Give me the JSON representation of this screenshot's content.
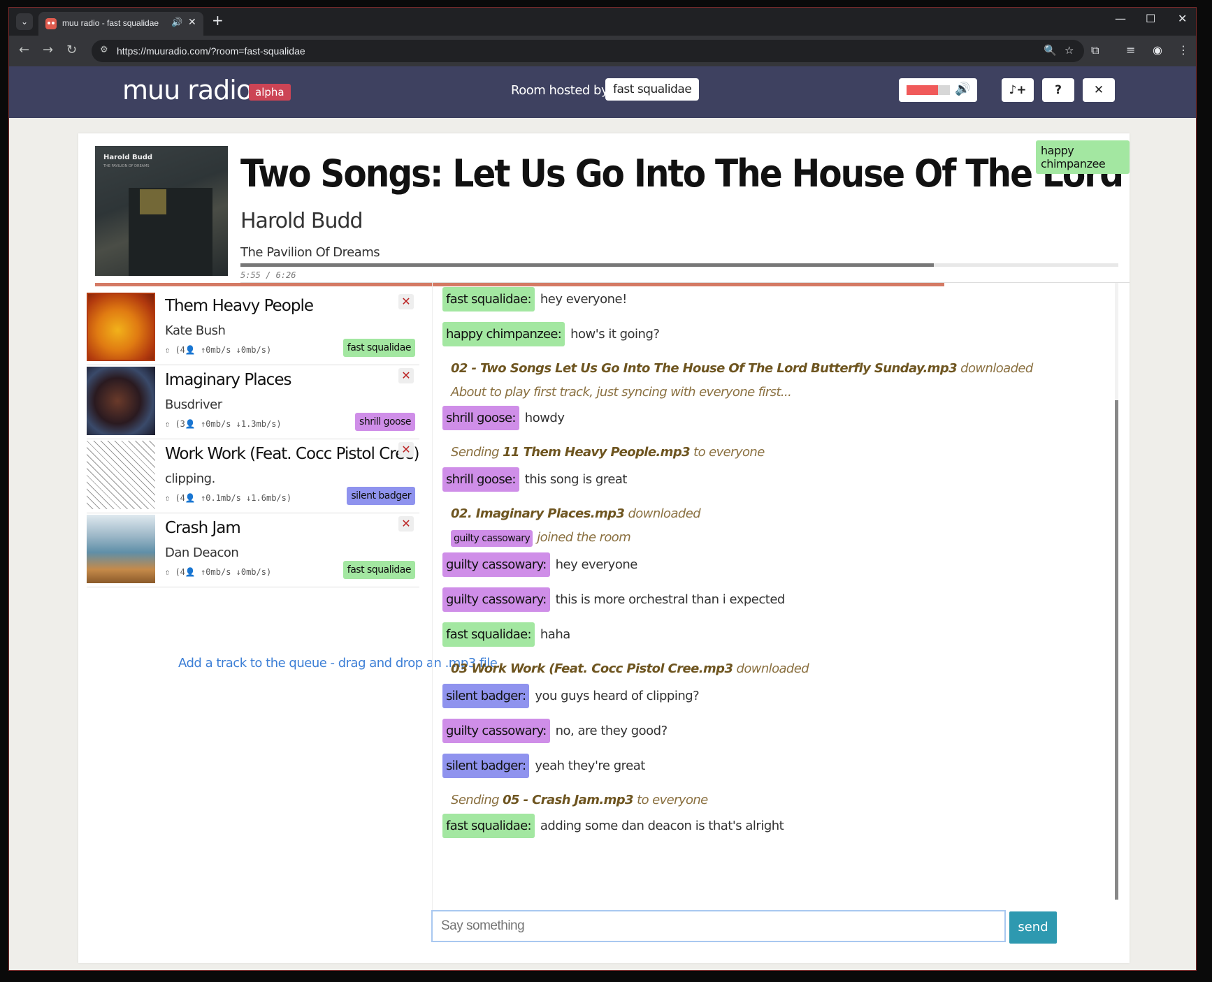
{
  "browser": {
    "tab_title": "muu radio - fast squalidae",
    "url": "https://muuradio.com/?room=fast-squalidae"
  },
  "header": {
    "logo": "muu radio",
    "badge": "alpha",
    "hosted_label": "Room hosted by",
    "host": "fast squalidae",
    "volume": 0.72,
    "add_track_label": "♪+",
    "help_label": "?",
    "close_label": "✕"
  },
  "now_playing": {
    "title": "Two Songs: Let Us Go Into The House Of The Lord / Butterfly Sunday",
    "artist": "Harold Budd",
    "album": "The Pavilion Of Dreams",
    "time": "5:55 / 6:26",
    "progress": 0.79,
    "download_progress": 0.83,
    "added_by": "happy chimpanzee",
    "art_text": "Harold Budd",
    "art_sub": "THE PAVILION OF DREAMS"
  },
  "queue": [
    {
      "title": "Them Heavy People",
      "artist": "Kate Bush",
      "stats": "⇧ (4👤 ↑0mb/s ↓0mb/s)",
      "added_by": "fast squalidae",
      "color": "#a3e7a1",
      "remove": "✕"
    },
    {
      "title": "Imaginary Places",
      "artist": "Busdriver",
      "stats": "⇧ (3👤 ↑0mb/s ↓1.3mb/s)",
      "added_by": "shrill goose",
      "color": "#cf8ee8",
      "remove": "✕"
    },
    {
      "title": "Work Work (Feat. Cocc Pistol Cree)",
      "artist": "clipping.",
      "stats": "⇧ (4👤 ↑0.1mb/s ↓1.6mb/s)",
      "added_by": "silent badger",
      "color": "#8f93ee",
      "remove": "✕"
    },
    {
      "title": "Crash Jam",
      "artist": "Dan Deacon",
      "stats": "⇧ (4👤 ↑0mb/s ↓0mb/s)",
      "added_by": "fast squalidae",
      "color": "#a3e7a1",
      "remove": "✕"
    }
  ],
  "queue_hint": "Add a track to the queue - drag and drop an .mp3 file",
  "chat": {
    "messages": [
      {
        "name": "fast squalidae:",
        "text": "hey everyone!"
      },
      {
        "name": "happy chimpanzee:",
        "text": "how's it going?"
      },
      {
        "bold": "02 - Two Songs Let Us Go Into The House Of The Lord Butterfly Sunday.mp3",
        "text": " downloaded"
      },
      {
        "text": "About to play first track, just syncing with everyone first..."
      },
      {
        "name": "shrill goose:",
        "text": "howdy"
      },
      {
        "pre": "Sending ",
        "bold": "11 Them Heavy People.mp3",
        "text": " to everyone"
      },
      {
        "name": "shrill goose:",
        "text": "this song is great"
      },
      {
        "bold": "02. Imaginary Places.mp3",
        "text": " downloaded"
      },
      {
        "badge": "guilty cassowary",
        "text": "joined the room"
      },
      {
        "name": "guilty cassowary:",
        "text": "hey everyone"
      },
      {
        "name": "guilty cassowary:",
        "text": "this is more orchestral than i expected"
      },
      {
        "name": "fast squalidae:",
        "text": "haha"
      },
      {
        "bold": "03 Work Work (Feat. Cocc Pistol Cree.mp3",
        "text": " downloaded"
      },
      {
        "name": "silent badger:",
        "text": "you guys heard of clipping?"
      },
      {
        "name": "guilty cassowary:",
        "text": "no, are they good?"
      },
      {
        "name": "silent badger:",
        "text": "yeah they're great"
      },
      {
        "pre": "Sending ",
        "bold": "05 - Crash Jam.mp3",
        "text": " to everyone"
      },
      {
        "name": "fast squalidae:",
        "text": "adding some dan deacon is that's alright"
      }
    ],
    "placeholder": "Say something",
    "send_label": "send"
  },
  "colors": {
    "fast squalidae": "#a3e7a1",
    "happy chimpanzee": "#a3e7a1",
    "shrill goose": "#cf8ee8",
    "guilty cassowary": "#cf8ee8",
    "silent badger": "#8f93ee",
    "header_bg": "#3e4160"
  }
}
